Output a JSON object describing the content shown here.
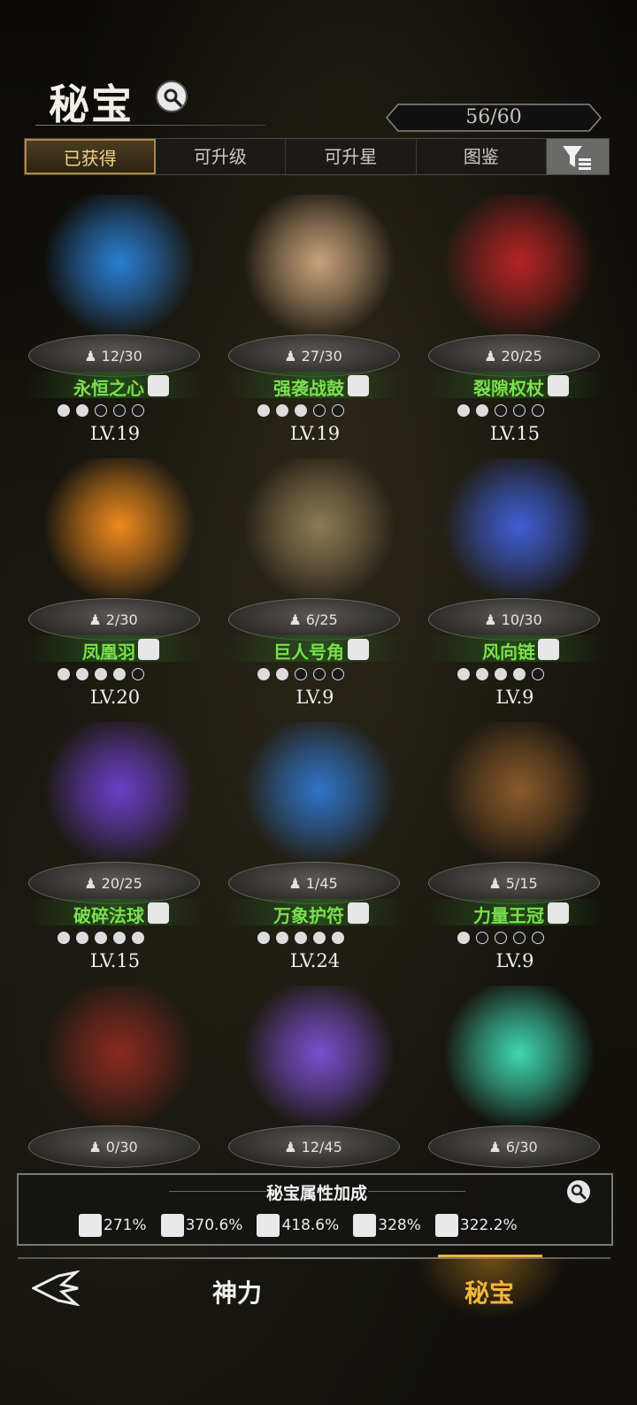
{
  "header": {
    "title": "秘宝",
    "counter": "56/60"
  },
  "tabs": [
    {
      "label": "已获得",
      "active": true
    },
    {
      "label": "可升级",
      "active": false
    },
    {
      "label": "可升星",
      "active": false
    },
    {
      "label": "图鉴",
      "active": false
    }
  ],
  "treasures": [
    {
      "name": "永恒之心",
      "fragments": "12/30",
      "level": "LV.19",
      "stars": 2,
      "stars_total": 5,
      "class_icon": "swirl-icon",
      "art_color": "#2a7fd4"
    },
    {
      "name": "强袭战鼓",
      "fragments": "27/30",
      "level": "LV.19",
      "stars": 3,
      "stars_total": 5,
      "class_icon": "swirl-icon",
      "art_color": "#c9a27a"
    },
    {
      "name": "裂隙权杖",
      "fragments": "20/25",
      "level": "LV.15",
      "stars": 2,
      "stars_total": 5,
      "class_icon": "heart-hand-icon",
      "art_color": "#b52424"
    },
    {
      "name": "凤凰羽",
      "fragments": "2/30",
      "level": "LV.20",
      "stars": 4,
      "stars_total": 5,
      "class_icon": "fist-icon",
      "art_color": "#ef8a1e"
    },
    {
      "name": "巨人号角",
      "fragments": "6/25",
      "level": "LV.9",
      "stars": 2,
      "stars_total": 5,
      "class_icon": "boot-icon",
      "art_color": "#8e7a52"
    },
    {
      "name": "风向链",
      "fragments": "10/30",
      "level": "LV.9",
      "stars": 4,
      "stars_total": 5,
      "class_icon": "fist-icon",
      "art_color": "#3f5fd6"
    },
    {
      "name": "破碎法球",
      "fragments": "20/25",
      "level": "LV.15",
      "stars": 5,
      "stars_total": 5,
      "class_icon": "boot-icon",
      "art_color": "#6a3fc9"
    },
    {
      "name": "万象护符",
      "fragments": "1/45",
      "level": "LV.24",
      "stars": 5,
      "stars_total": 5,
      "class_icon": "boot-icon",
      "art_color": "#2f74c8"
    },
    {
      "name": "力量王冠",
      "fragments": "5/15",
      "level": "LV.9",
      "stars": 1,
      "stars_total": 5,
      "class_icon": "swirl-icon",
      "art_color": "#8a5a2a"
    },
    {
      "name": "",
      "fragments": "0/30",
      "level": "",
      "stars": 0,
      "stars_total": 0,
      "class_icon": "",
      "art_color": "#8a2a1f"
    },
    {
      "name": "",
      "fragments": "12/45",
      "level": "",
      "stars": 0,
      "stars_total": 0,
      "class_icon": "",
      "art_color": "#7a4fd0"
    },
    {
      "name": "",
      "fragments": "6/30",
      "level": "",
      "stars": 0,
      "stars_total": 0,
      "class_icon": "",
      "art_color": "#3fd8b0"
    }
  ],
  "bonus": {
    "title": "秘宝属性加成",
    "stats": [
      {
        "icon": "sword-icon",
        "value": "271%"
      },
      {
        "icon": "fist-icon",
        "value": "370.6%"
      },
      {
        "icon": "swirl-icon",
        "value": "418.6%"
      },
      {
        "icon": "boot-icon",
        "value": "328%"
      },
      {
        "icon": "heart-hand-icon",
        "value": "322.2%"
      }
    ]
  },
  "nav": {
    "divine": "神力",
    "treasure": "秘宝"
  }
}
